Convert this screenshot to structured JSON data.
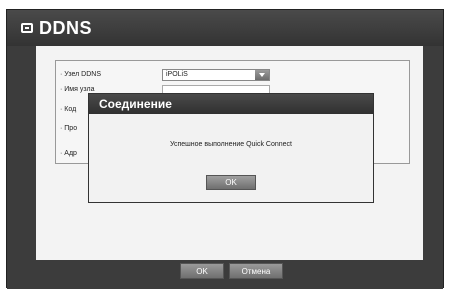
{
  "window": {
    "title": "DDNS"
  },
  "form": {
    "rows": [
      {
        "label": "· Узел DDNS"
      },
      {
        "label": "· Имя узла"
      },
      {
        "label": "· Код"
      },
      {
        "label": "· Про"
      },
      {
        "label": "· Адр"
      }
    ],
    "host_select": {
      "value": "iPOLiS"
    }
  },
  "dialog": {
    "title": "Соединение",
    "message": "Успешное выполнение Quick Connect",
    "ok_label": "OK"
  },
  "footer": {
    "ok_label": "OK",
    "cancel_label": "Отмена"
  }
}
